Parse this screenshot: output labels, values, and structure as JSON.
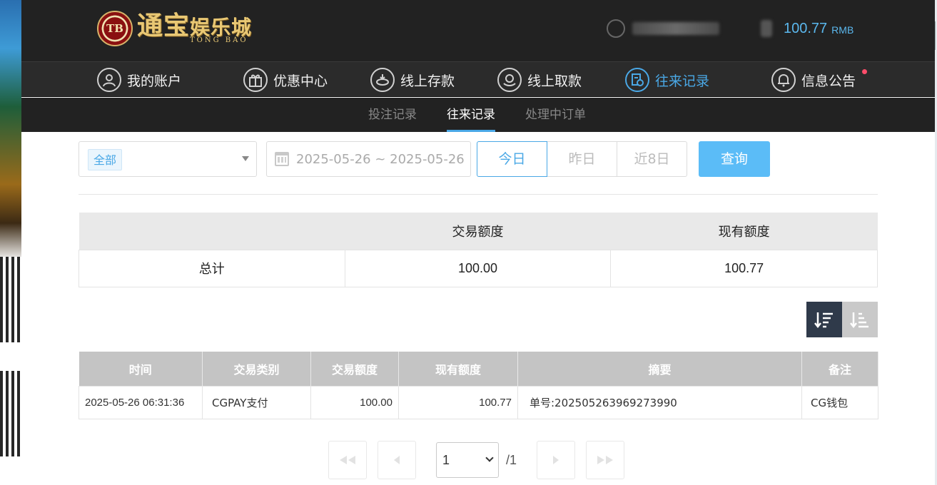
{
  "logo": {
    "badge": "TB",
    "main_part1": "通宝",
    "main_part2": "娱乐城",
    "sub": "TONG BAO"
  },
  "account": {
    "balance": "100.77",
    "currency": "RMB"
  },
  "nav": {
    "items": [
      {
        "label": "我的账户",
        "icon": "user-icon"
      },
      {
        "label": "优惠中心",
        "icon": "gift-icon"
      },
      {
        "label": "线上存款",
        "icon": "deposit-icon"
      },
      {
        "label": "线上取款",
        "icon": "withdraw-icon"
      },
      {
        "label": "往来记录",
        "icon": "records-icon",
        "active": true
      },
      {
        "label": "信息公告",
        "icon": "bell-icon",
        "badge_dot": true
      }
    ]
  },
  "subnav": {
    "tabs": [
      "投注记录",
      "往来记录",
      "处理中订单"
    ],
    "active_index": 1
  },
  "filters": {
    "type_tag": "全部",
    "date_range": "2025-05-26 ~ 2025-05-26",
    "quick": [
      "今日",
      "昨日",
      "近8日"
    ],
    "quick_active_index": 0,
    "query_label": "查询"
  },
  "summary": {
    "headers": [
      "",
      "交易额度",
      "现有额度"
    ],
    "row_label": "总计",
    "transaction_amount": "100.00",
    "current_amount": "100.77"
  },
  "records": {
    "headers": [
      "时间",
      "交易类别",
      "交易额度",
      "现有额度",
      "摘要",
      "备注"
    ],
    "rows": [
      {
        "time": "2025-05-26 06:31:36",
        "type": "CGPAY支付",
        "amount": "100.00",
        "balance": "100.77",
        "summary": "单号:202505263969273990",
        "remark": "CG钱包"
      }
    ]
  },
  "pagination": {
    "current": "1",
    "total": "/1"
  },
  "colors": {
    "accent": "#4aa8e6",
    "query_btn": "#5bbcf7",
    "header_dark": "#222222",
    "notice_dot": "#ff4d6a"
  }
}
